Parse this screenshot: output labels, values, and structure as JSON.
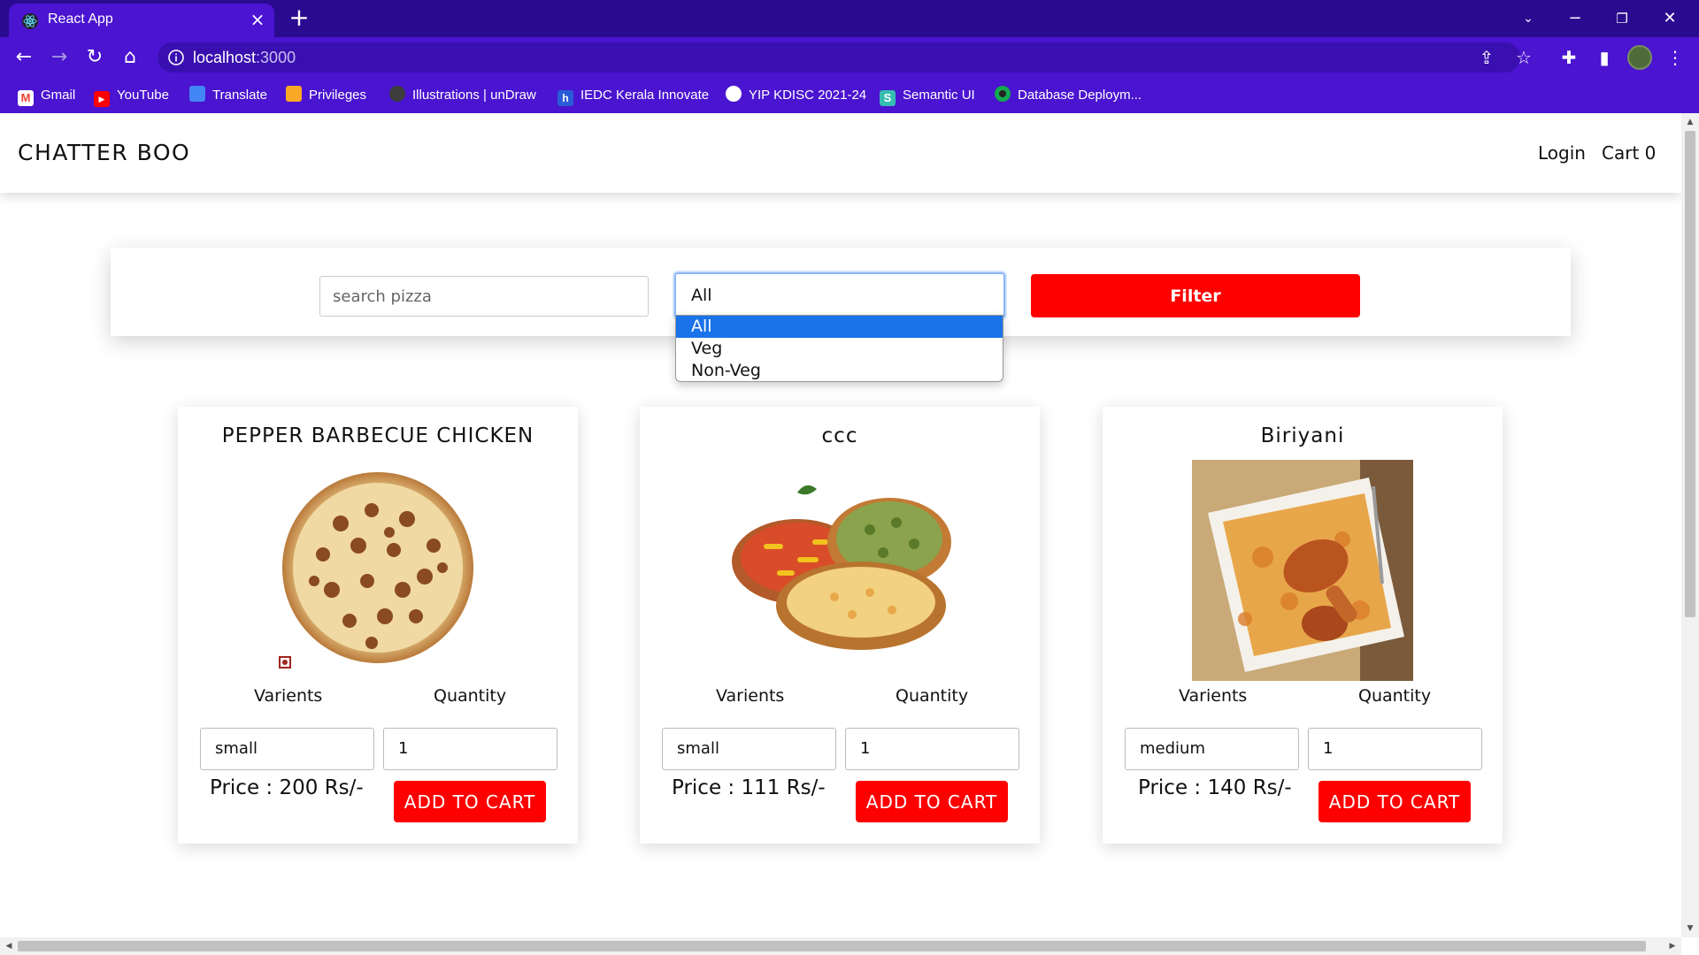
{
  "browser": {
    "tab_title": "React App",
    "url_host": "localhost",
    "url_port": ":3000",
    "bookmarks": [
      {
        "label": "Gmail",
        "icon": "gmail-icon",
        "color": "#ea4335"
      },
      {
        "label": "YouTube",
        "icon": "youtube-icon",
        "color": "#ff0000"
      },
      {
        "label": "Translate",
        "icon": "translate-icon",
        "color": "#4285f4"
      },
      {
        "label": "Privileges",
        "icon": "privileges-icon",
        "color": "#f9a825"
      },
      {
        "label": "Illustrations | unDraw",
        "icon": "undraw-icon",
        "color": "#3d3d3d"
      },
      {
        "label": "IEDC Kerala Innovate",
        "icon": "iedc-icon",
        "color": "#2a5bd7"
      },
      {
        "label": "YIP KDISC 2021-24",
        "icon": "yip-icon",
        "color": "#ffffff"
      },
      {
        "label": "Semantic UI",
        "icon": "semantic-ui-icon",
        "color": "#35bdb2"
      },
      {
        "label": "Database Deploym...",
        "icon": "mongodb-icon",
        "color": "#13aa52"
      }
    ]
  },
  "navbar": {
    "brand": "CHATTER BOO",
    "login": "Login",
    "cart": "Cart 0"
  },
  "filter": {
    "search_placeholder": "search pizza",
    "category_selected": "All",
    "category_options": [
      "All",
      "Veg",
      "Non-Veg"
    ],
    "filter_label": "Filter"
  },
  "products": [
    {
      "name": "PEPPER BARBECUE CHICKEN",
      "variants_label": "Varients",
      "quantity_label": "Quantity",
      "variant": "small",
      "quantity": "1",
      "price": "Price : 200 Rs/-",
      "button": "ADD TO CART",
      "image": "pizza-image"
    },
    {
      "name": "ccc",
      "variants_label": "Varients",
      "quantity_label": "Quantity",
      "variant": "small",
      "quantity": "1",
      "price": "Price : 111 Rs/-",
      "button": "ADD TO CART",
      "image": "three-pizzas-image"
    },
    {
      "name": "Biriyani",
      "variants_label": "Varients",
      "quantity_label": "Quantity",
      "variant": "medium",
      "quantity": "1",
      "price": "Price : 140 Rs/-",
      "button": "ADD TO CART",
      "image": "biriyani-image"
    }
  ],
  "colors": {
    "chrome": "#4a14d0",
    "accent_red": "#ff0000",
    "select_highlight": "#1a73e8"
  }
}
